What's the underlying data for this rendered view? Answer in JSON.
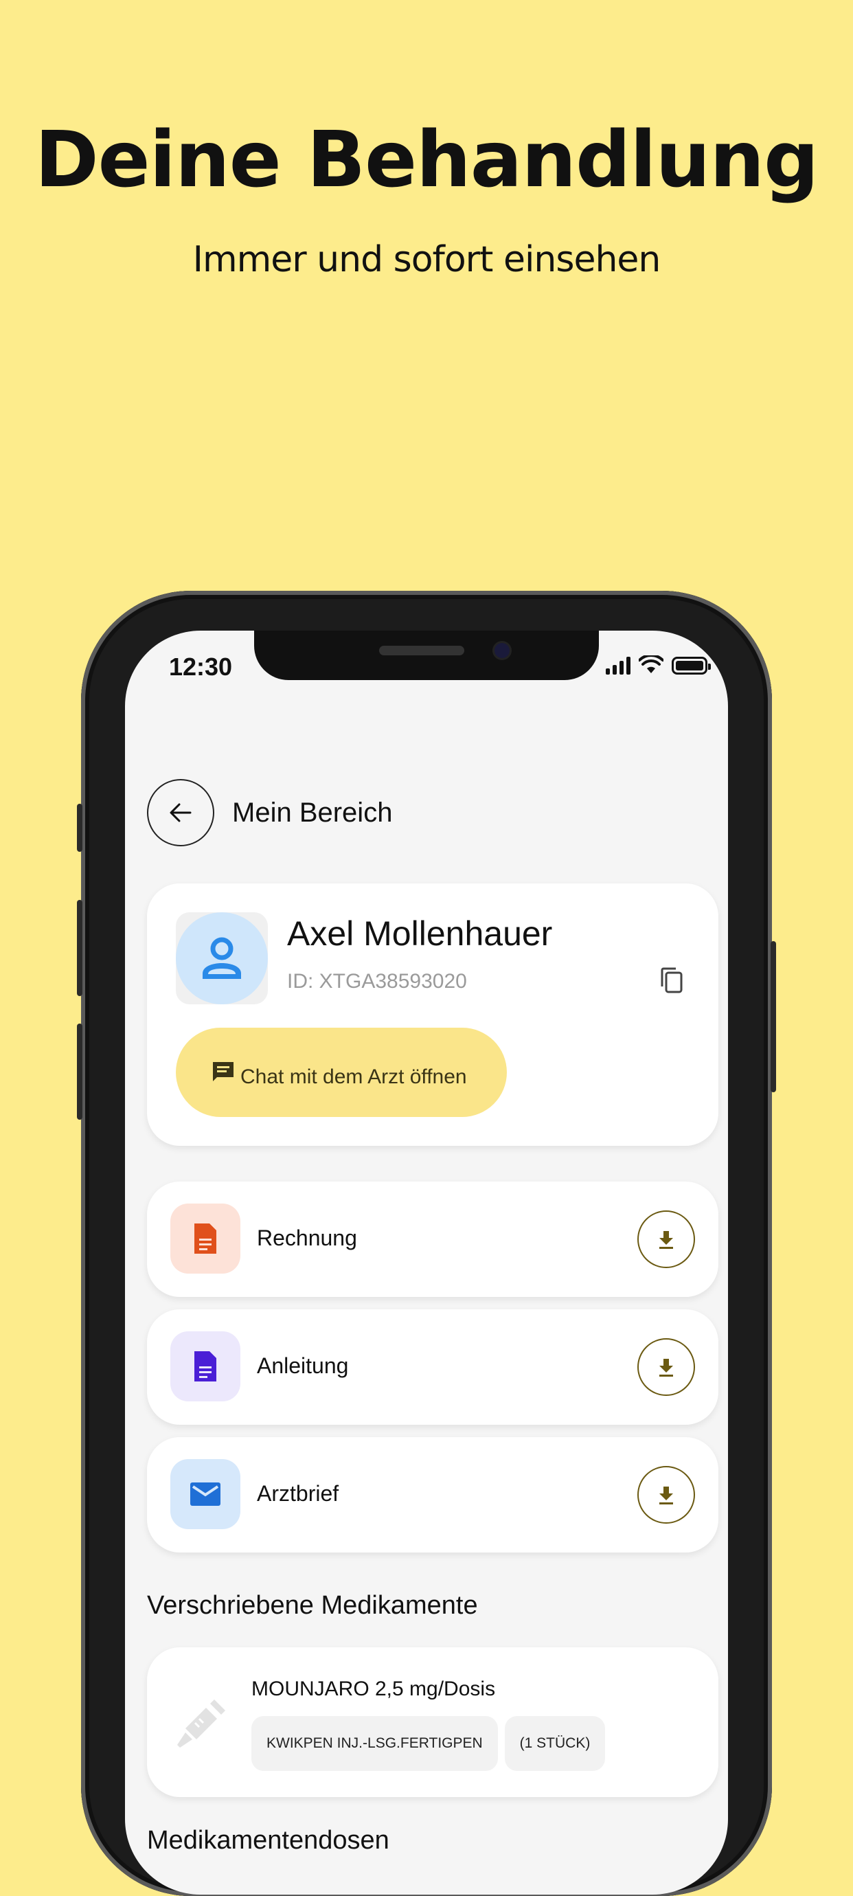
{
  "colors": {
    "background": "#fdec8c",
    "accent_button": "#fae58a",
    "download_outline": "#6b5a12"
  },
  "promo": {
    "headline": "Deine Behandlung",
    "subline": "Immer und sofort einsehen"
  },
  "status_bar": {
    "time": "12:30",
    "icons": [
      "signal-icon",
      "wifi-icon",
      "battery-icon"
    ]
  },
  "topbar": {
    "title": "Mein Bereich",
    "back_icon": "arrow-left-icon"
  },
  "profile": {
    "name": "Axel Mollenhauer",
    "id_text": "ID: XTGA38593020",
    "avatar_icon": "person-icon",
    "copy_icon": "copy-icon",
    "chat_button_label": "Chat mit dem Arzt öffnen",
    "chat_icon": "chat-icon"
  },
  "documents": [
    {
      "label": "Rechnung",
      "icon": "document-icon",
      "icon_color": "#e0501b",
      "icon_bg": "#fde2d8"
    },
    {
      "label": "Anleitung",
      "icon": "document-icon",
      "icon_color": "#4a1fd6",
      "icon_bg": "#ece8fc"
    },
    {
      "label": "Arztbrief",
      "icon": "mail-icon",
      "icon_color": "#1f6fd6",
      "icon_bg": "#d6e8fb"
    }
  ],
  "medications": {
    "section_title": "Verschriebene Medikamente",
    "items": [
      {
        "name": "MOUNJARO 2,5 mg/Dosis",
        "chips": [
          "KWIKPEN INJ.-LSG.FERTIGPEN",
          "(1 STÜCK)"
        ],
        "icon": "syringe-icon"
      }
    ]
  },
  "next_section_title": "Medikamentendosen"
}
